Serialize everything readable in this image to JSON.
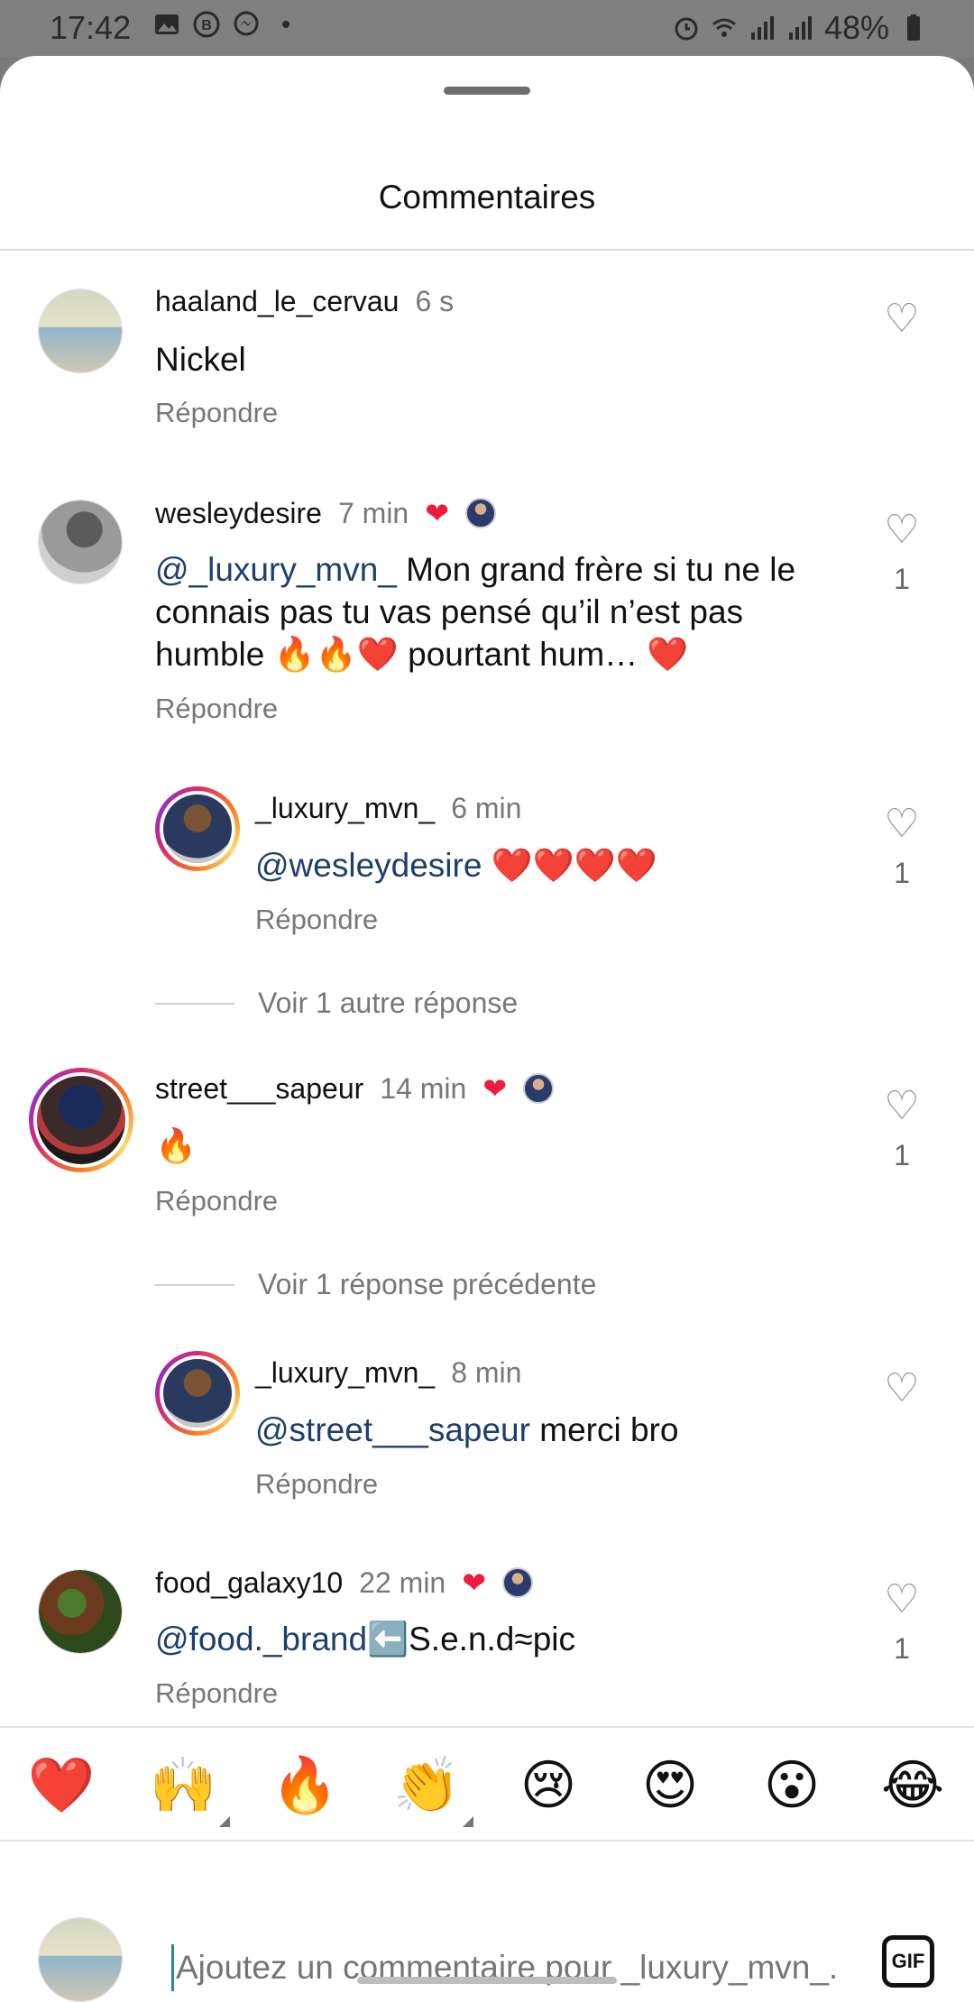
{
  "status_bar": {
    "time": "17:42",
    "battery": "48%"
  },
  "sheet": {
    "title": "Commentaires"
  },
  "comments": [
    {
      "username": "haaland_le_cervau",
      "time": "6 s",
      "text": "Nickel",
      "reply_label": "Répondre",
      "likes": ""
    },
    {
      "username": "wesleydesire",
      "time": "7 min",
      "mention": "@_luxury_mvn_",
      "text": " Mon grand frère si tu  ne le connais pas tu vas pensé qu’il n’est pas humble 🔥🔥❤️ pourtant hum… ❤️",
      "reply_label": "Répondre",
      "likes": "1"
    },
    {
      "username": "_luxury_mvn_",
      "time": "6 min",
      "mention": "@wesleydesire",
      "text": " ❤️❤️❤️❤️",
      "reply_label": "Répondre",
      "likes": "1"
    },
    {
      "username": "street___sapeur",
      "time": "14 min",
      "text": "🔥",
      "reply_label": "Répondre",
      "likes": "1"
    },
    {
      "username": "_luxury_mvn_",
      "time": "8 min",
      "mention": "@street___sapeur",
      "text": " merci bro",
      "reply_label": "Répondre",
      "likes": ""
    },
    {
      "username": "food_galaxy10",
      "time": "22 min",
      "mention": "@food._brand",
      "text": "⬅️S.e.n.d≈pic",
      "reply_label": "Répondre",
      "likes": "1"
    }
  ],
  "view_replies": [
    "Voir 1 autre réponse",
    "Voir 1 réponse précédente"
  ],
  "emoji_bar": [
    "❤️",
    "🙌",
    "🔥",
    "👏",
    "😢",
    "😍",
    "😮",
    "😂"
  ],
  "composer": {
    "placeholder": "Ajoutez un commentaire pour _luxury_mvn_...",
    "gif_label": "GIF"
  },
  "colors": {
    "mention": "#1d3f6e",
    "like_heart": "#ed1c3c",
    "secondary_text": "#777777"
  }
}
